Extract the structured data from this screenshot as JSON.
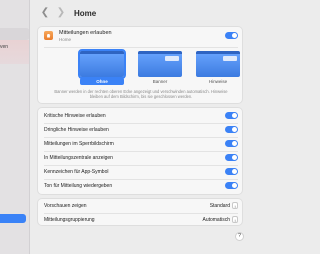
{
  "toolbar": {
    "back_icon": "chevron-left-icon",
    "forward_icon": "chevron-right-icon",
    "title": "Home"
  },
  "sidebar": {
    "visible_label": "ven",
    "accent": "#3a82f7"
  },
  "app": {
    "icon": "home-app-icon",
    "allow_label": "Mitteilungen erlauben",
    "app_name": "Home",
    "allow_enabled": true
  },
  "styles": {
    "items": [
      {
        "label": "Ohne",
        "selected": true
      },
      {
        "label": "Banner",
        "selected": false
      },
      {
        "label": "Hinweise",
        "selected": false
      }
    ],
    "description": "Banner werden in der rechten oberen Ecke angezeigt und verschwinden automatisch. Hinweise bleiben auf dem Bildschirm, bis sie geschlossen werden."
  },
  "toggles": [
    {
      "label": "Kritische Hinweise erlauben",
      "on": true
    },
    {
      "label": "Dringliche Hinweise erlauben",
      "on": true
    },
    {
      "label": "Mitteilungen im Sperrbildschirm",
      "on": true
    },
    {
      "label": "In Mitteilungszentrale anzeigen",
      "on": true
    },
    {
      "label": "Kennzeichen für App-Symbol",
      "on": true
    },
    {
      "label": "Ton für Mitteilung wiedergeben",
      "on": true
    }
  ],
  "popups": [
    {
      "label": "Vorschauen zeigen",
      "value": "Standard"
    },
    {
      "label": "Mitteilungsgruppierung",
      "value": "Automatisch"
    }
  ],
  "help_label": "?",
  "colors": {
    "accent": "#3b82f6",
    "background": "#ececec",
    "card": "#f7f7f7"
  }
}
